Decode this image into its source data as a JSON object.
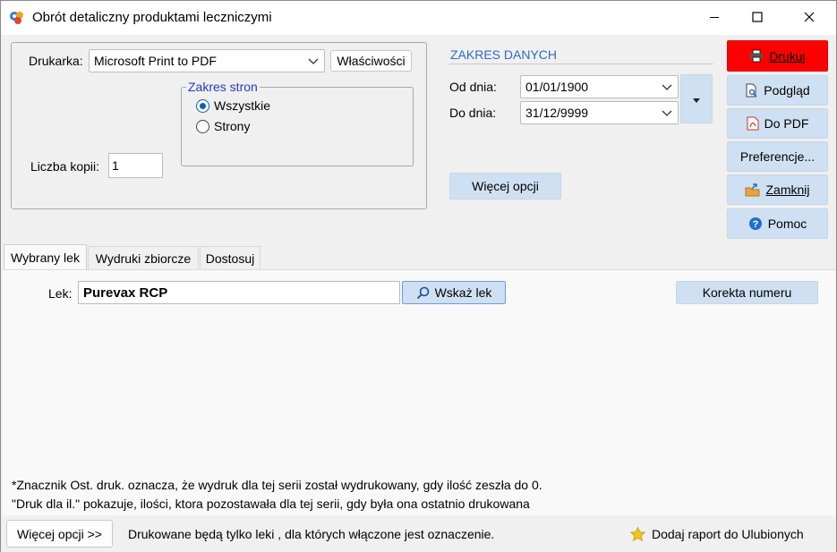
{
  "window": {
    "title": "Obrót detaliczny produktami leczniczymi"
  },
  "printer": {
    "label": "Drukarka:",
    "value": "Microsoft Print to PDF",
    "properties_button": "Właściwości"
  },
  "page_range": {
    "legend": "Zakres stron",
    "options": [
      "Wszystkie",
      "Strony"
    ],
    "selected": "Wszystkie"
  },
  "copies": {
    "label": "Liczba kopii:",
    "value": "1"
  },
  "data_range": {
    "header": "ZAKRES DANYCH",
    "from_label": "Od dnia:",
    "from_value": "01/01/1900",
    "to_label": "Do dnia:",
    "to_value": "31/12/9999",
    "more_options_button": "Więcej opcji"
  },
  "actions": {
    "print": "Drukuj",
    "preview": "Podgląd",
    "to_pdf": "Do PDF",
    "preferences": "Preferencje...",
    "close": "Zamknij",
    "help": "Pomoc"
  },
  "tabs": [
    "Wybrany lek",
    "Wydruki zbiorcze",
    "Dostosuj"
  ],
  "drug": {
    "label": "Lek:",
    "value": "Purevax RCP",
    "select_button": "Wskaż lek",
    "correct_number_button": "Korekta numeru"
  },
  "notes": {
    "line1": "*Znacznik Ost. druk. oznacza, że wydruk dla tej serii został wydrukowany, gdy ilość zeszła do 0.",
    "line2": "\"Druk dla il.\" pokazuje, ilości, ktora pozostawała dla tej serii, gdy była ona ostatnio drukowana"
  },
  "footer": {
    "more_options_button": "Więcej opcji >>",
    "info_text": "Drukowane będą tylko leki , dla których  włączone jest oznaczenie.",
    "favorites_button": "Dodaj raport do Ulubionych"
  },
  "colors": {
    "print_button": "#ff0000",
    "action_button": "#cfe0f2",
    "header_text": "#2b6cc4",
    "legend_text": "#1f3fbf"
  },
  "icons": {
    "app": "app-logo-icon",
    "print": "printer-icon",
    "preview": "preview-icon",
    "pdf": "pdf-icon",
    "close": "folder-exit-icon",
    "help": "help-icon",
    "search": "search-icon",
    "favorite": "star-icon"
  }
}
